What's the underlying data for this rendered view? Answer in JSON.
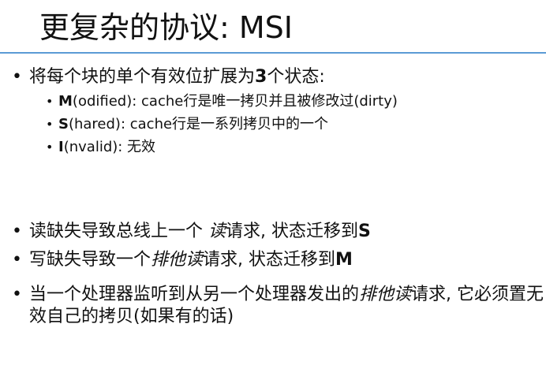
{
  "slide": {
    "title": "更复杂的协议: MSI",
    "bullets": [
      {
        "text_before": "将每个块的单个有效位扩展为",
        "number": "3",
        "text_after": "个状态:"
      },
      {
        "text_before": "读缺失导致总线上一个 ",
        "emphasis": "读",
        "text_after": "请求, 状态迁移到",
        "strong": "S"
      },
      {
        "text_before": "写缺失导致一个",
        "emphasis": "排他读",
        "text_after": "请求, 状态迁移到",
        "strong": "M"
      },
      {
        "text_before": "当一个处理器监听到从另一个处理器发出的",
        "emphasis": "排他读",
        "text_after": "请求, 它必须置无效自己的拷贝(如果有的话)"
      }
    ],
    "states": [
      {
        "strong": "M",
        "text": "(odified): cache行是唯一拷贝并且被修改过(dirty)"
      },
      {
        "strong": "S",
        "text": "(hared): cache行是一系列拷贝中的一个"
      },
      {
        "strong": "I",
        "text": "(nvalid): 无效"
      }
    ],
    "bullet_symbol": "•",
    "accent_color": "#5b9bd5"
  }
}
